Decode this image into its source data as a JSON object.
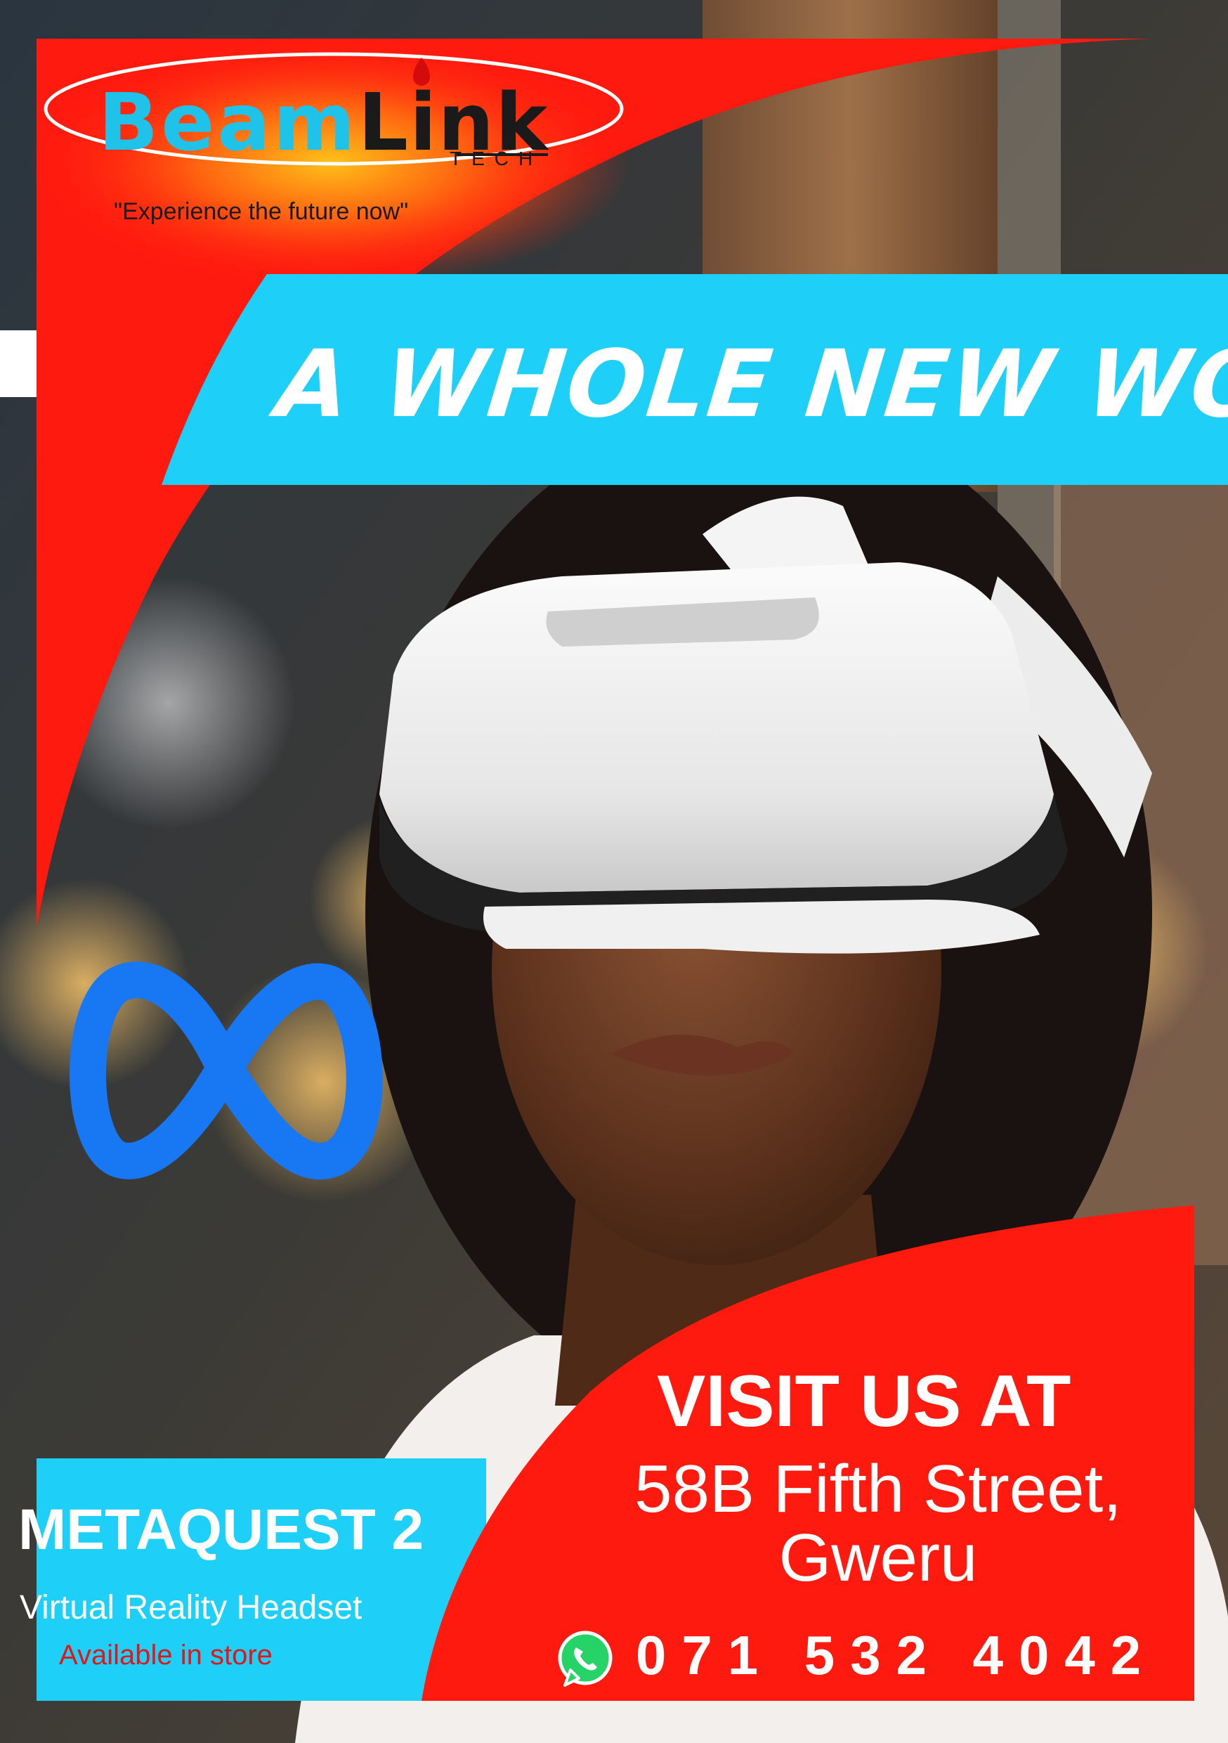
{
  "brand": {
    "name_part1": "Beam",
    "name_part2": "Link",
    "suffix": "TECH",
    "slogan": "\"Experience the future now\""
  },
  "headline": "A WHOLE NEW WORLD",
  "product": {
    "name": "METAQUEST 2",
    "description": "Virtual Reality Headset",
    "availability": "Available in store",
    "headset_brand_text": "",
    "logo_icon": "meta-infinity-logo-icon"
  },
  "contact": {
    "visit_title": "VISIT US AT",
    "address_line1": "58B Fifth Street,",
    "address_line2": "Gweru",
    "phone": "071 532 4042",
    "phone_icon": "whatsapp-icon"
  },
  "colors": {
    "red": "#ff1a0f",
    "cyan": "#1ed0f7",
    "meta_blue": "#1877f2",
    "white": "#ffffff",
    "dark": "#1a1a1a"
  }
}
